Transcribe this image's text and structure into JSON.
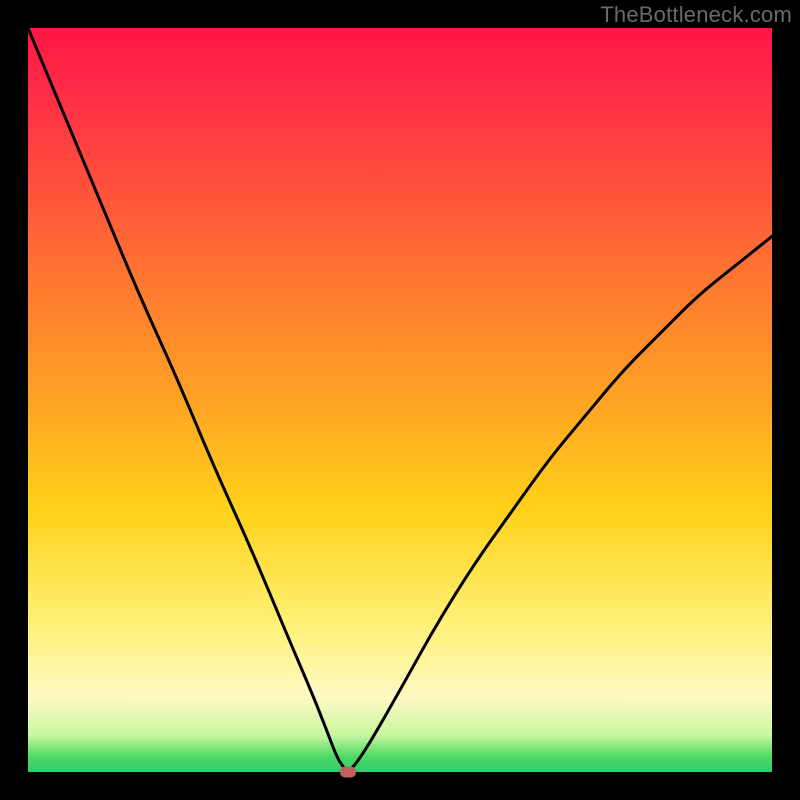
{
  "watermark": "TheBottleneck.com",
  "colors": {
    "frame": "#000000",
    "curve": "#000000",
    "marker": "#c1605f",
    "gradient_top": "#ff1744",
    "gradient_bottom": "#2ecc71"
  },
  "chart_data": {
    "type": "line",
    "title": "",
    "xlabel": "",
    "ylabel": "",
    "xlim": [
      0,
      100
    ],
    "ylim": [
      0,
      100
    ],
    "series": [
      {
        "name": "bottleneck-curve",
        "x": [
          0,
          5,
          10,
          15,
          20,
          25,
          30,
          35,
          38,
          40,
          41.5,
          42.5,
          43,
          44,
          46,
          50,
          55,
          60,
          65,
          70,
          75,
          80,
          85,
          90,
          95,
          100
        ],
        "y": [
          100,
          88,
          76,
          64,
          53,
          41,
          30,
          18,
          11,
          6,
          2,
          0.5,
          0,
          1,
          4,
          11,
          20,
          28,
          35,
          42,
          48,
          54,
          59,
          64,
          68,
          72
        ]
      }
    ],
    "annotations": [
      {
        "name": "min-marker",
        "x": 43,
        "y": 0
      }
    ],
    "grid": false,
    "legend_position": "none"
  }
}
